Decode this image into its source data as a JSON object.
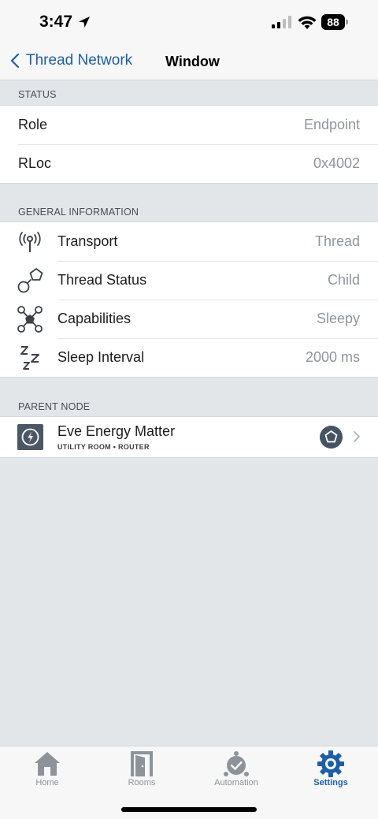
{
  "status_bar": {
    "time": "3:47",
    "battery": "88"
  },
  "nav": {
    "back_label": "Thread Network",
    "title": "Window"
  },
  "sections": {
    "status": {
      "header": "STATUS",
      "rows": [
        {
          "label": "Role",
          "value": "Endpoint"
        },
        {
          "label": "RLoc",
          "value": "0x4002"
        }
      ]
    },
    "general": {
      "header": "GENERAL INFORMATION",
      "rows": [
        {
          "icon": "antenna-icon",
          "label": "Transport",
          "value": "Thread"
        },
        {
          "icon": "thread-status-icon",
          "label": "Thread Status",
          "value": "Child"
        },
        {
          "icon": "capabilities-icon",
          "label": "Capabilities",
          "value": "Sleepy"
        },
        {
          "icon": "sleep-icon",
          "label": "Sleep Interval",
          "value": "2000 ms"
        }
      ]
    },
    "parent": {
      "header": "PARENT NODE",
      "name": "Eve Energy Matter",
      "subtitle": "UTILITY ROOM • ROUTER"
    }
  },
  "tabs": [
    {
      "label": "Home",
      "icon": "home-icon",
      "active": false
    },
    {
      "label": "Rooms",
      "icon": "door-icon",
      "active": false
    },
    {
      "label": "Automation",
      "icon": "automation-icon",
      "active": false
    },
    {
      "label": "Settings",
      "icon": "gear-icon",
      "active": true
    }
  ],
  "colors": {
    "accent": "#1f5da6",
    "background": "#e3e6e9",
    "value_gray": "#8e959c"
  }
}
